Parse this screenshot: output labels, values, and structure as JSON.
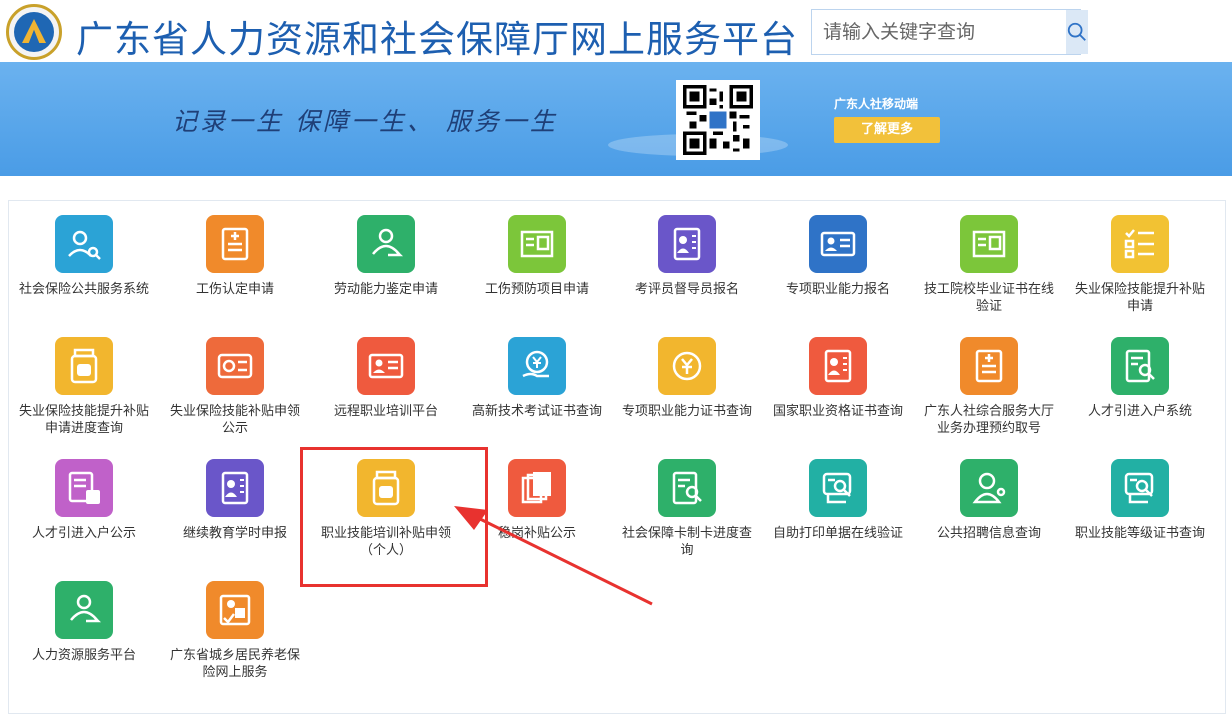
{
  "header": {
    "title": "广东省人力资源和社会保障厅网上服务平台",
    "search_placeholder": "请输入关键字查询"
  },
  "banner": {
    "slogan": "记录一生  保障一生、 服务一生",
    "mobile_label": "广东人社移动端",
    "more_label": "了解更多"
  },
  "colors": {
    "brand": "#1d5fb0",
    "banner": "#4a9ce6",
    "highlight": "#e8322f"
  },
  "services": [
    {
      "label": "社会保险公共服务系统",
      "color": "#2ba3d6",
      "icon": "user-search-icon"
    },
    {
      "label": "工伤认定申请",
      "color": "#f08a2b",
      "icon": "document-plus-icon"
    },
    {
      "label": "劳动能力鉴定申请",
      "color": "#2eb06a",
      "icon": "user-transfer-icon"
    },
    {
      "label": "工伤预防项目申请",
      "color": "#7cc63a",
      "icon": "certificate-icon"
    },
    {
      "label": "考评员督导员报名",
      "color": "#6a56c9",
      "icon": "badge-person-icon"
    },
    {
      "label": "专项职业能力报名",
      "color": "#2f73c7",
      "icon": "id-card-icon"
    },
    {
      "label": "技工院校毕业证书在线验证",
      "color": "#7cc63a",
      "icon": "certificate-icon"
    },
    {
      "label": "失业保险技能提升补贴申请",
      "color": "#f2c233",
      "icon": "checklist-icon"
    },
    {
      "label": "失业保险技能提升补贴申请进度查询",
      "color": "#f2b62e",
      "icon": "pill-bottle-icon"
    },
    {
      "label": "失业保险技能补贴申领公示",
      "color": "#ee6a3b",
      "icon": "social-card-icon"
    },
    {
      "label": "远程职业培训平台",
      "color": "#ef5a3e",
      "icon": "id-card-icon"
    },
    {
      "label": "高新技术考试证书查询",
      "color": "#2ba3d6",
      "icon": "yuan-hand-icon"
    },
    {
      "label": "专项职业能力证书查询",
      "color": "#f2b62e",
      "icon": "yuan-circle-icon"
    },
    {
      "label": "国家职业资格证书查询",
      "color": "#ef5a3e",
      "icon": "badge-person-icon"
    },
    {
      "label": "广东人社综合服务大厅业务办理预约取号",
      "color": "#f08a2b",
      "icon": "document-plus-icon"
    },
    {
      "label": "人才引进入户系统",
      "color": "#2eb06a",
      "icon": "file-search-icon"
    },
    {
      "label": "人才引进入户公示",
      "color": "#c061c9",
      "icon": "file-dollar-icon"
    },
    {
      "label": "继续教育学时申报",
      "color": "#6a56c9",
      "icon": "badge-person-icon"
    },
    {
      "label": "职业技能培训补贴申领（个人）",
      "color": "#f2b62e",
      "icon": "pill-bottle-icon"
    },
    {
      "label": "稳岗补贴公示",
      "color": "#ef5a3e",
      "icon": "stacked-docs-icon"
    },
    {
      "label": "社会保障卡制卡进度查询",
      "color": "#2eb06a",
      "icon": "file-search-icon"
    },
    {
      "label": "自助打印单据在线验证",
      "color": "#22b0a4",
      "icon": "print-verify-icon"
    },
    {
      "label": "公共招聘信息查询",
      "color": "#2eb06a",
      "icon": "doctor-icon"
    },
    {
      "label": "职业技能等级证书查询",
      "color": "#22b0a4",
      "icon": "print-verify-icon"
    },
    {
      "label": "人力资源服务平台",
      "color": "#2eb06a",
      "icon": "user-transfer-icon"
    },
    {
      "label": "广东省城乡居民养老保险网上服务",
      "color": "#f08a2b",
      "icon": "elder-care-icon"
    }
  ]
}
